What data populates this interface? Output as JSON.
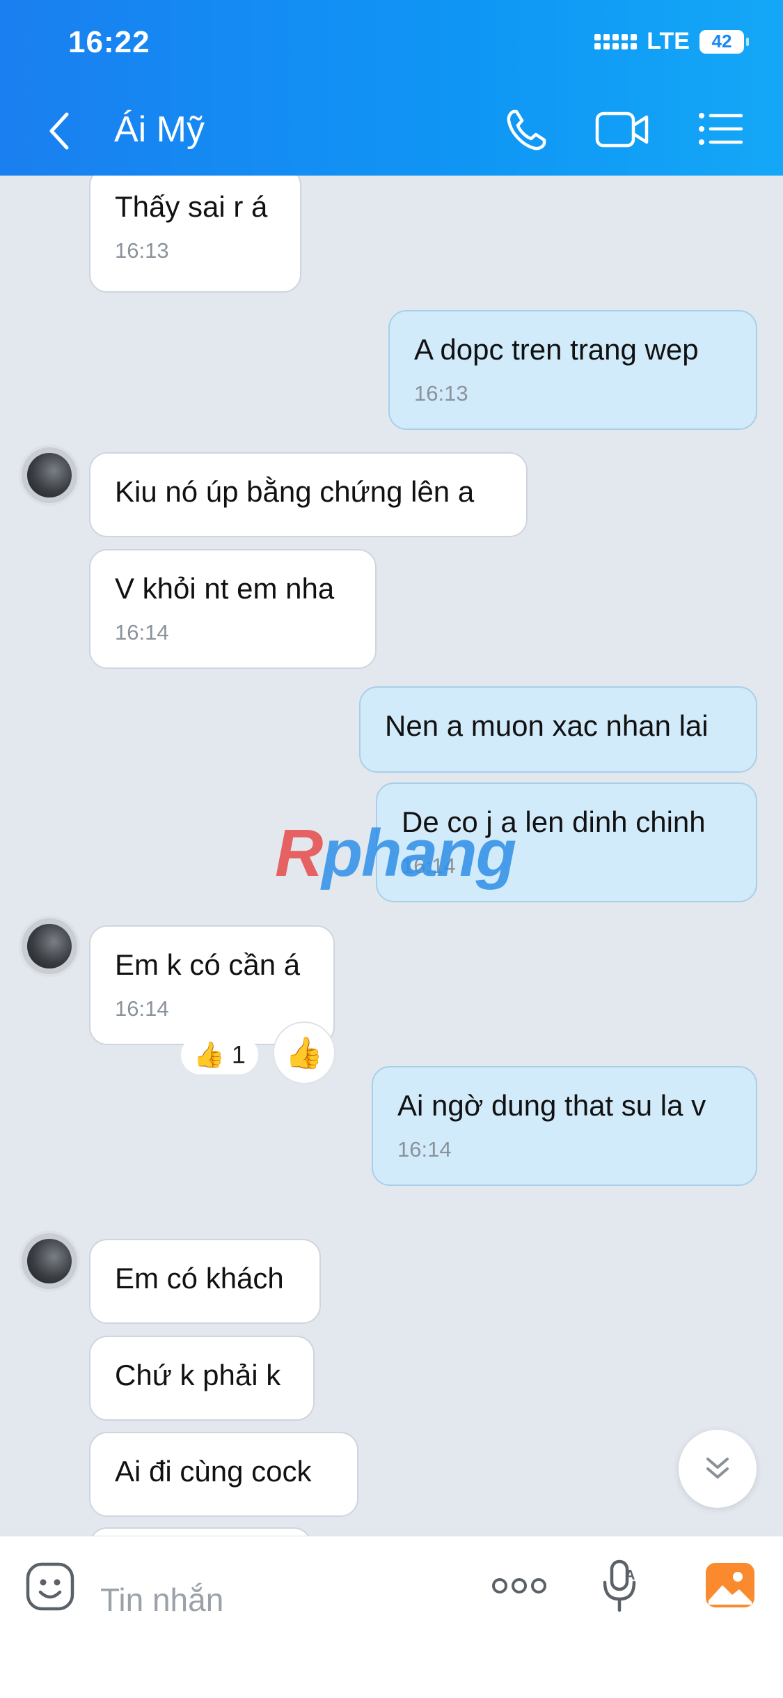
{
  "status_bar": {
    "time": "16:22",
    "network": "LTE",
    "battery": "42"
  },
  "header": {
    "contact_name": "Ái Mỹ"
  },
  "messages": [
    {
      "text": "Thấy sai r á",
      "time": "16:13"
    },
    {
      "text": "A dopc tren trang wep",
      "time": "16:13"
    },
    {
      "text": "Kiu nó úp bằng chứng lên a"
    },
    {
      "text": "V khỏi nt em nha",
      "time": "16:14"
    },
    {
      "text": "Nen a muon xac nhan lai"
    },
    {
      "text": "De co j a len dinh chinh",
      "time": "16:14"
    },
    {
      "text": "Em k có cần á",
      "time": "16:14"
    },
    {
      "text": "Ai ngờ dung that su la v",
      "time": "16:14"
    },
    {
      "text": "Em có khách"
    },
    {
      "text": "Chứ k phải k"
    },
    {
      "text": "Ai đi cùng cock"
    }
  ],
  "reaction": {
    "emoji": "👍",
    "count": "1"
  },
  "watermark": {
    "first": "R",
    "rest": "phang"
  },
  "input": {
    "placeholder": "Tin nhắn"
  },
  "colors": {
    "header": "#1a88f2",
    "outgoing_bubble": "#d2ebfb",
    "incoming_bubble": "#ffffff",
    "background": "#e3e8ef"
  },
  "icons": {
    "back": "chevron-left-icon",
    "call": "phone-icon",
    "video": "video-camera-icon",
    "menu": "list-menu-icon",
    "sticker": "emoji-face-icon",
    "more": "more-dots-icon",
    "voice": "microphone-icon",
    "image": "image-gallery-icon",
    "scroll": "double-chevron-down-icon"
  }
}
